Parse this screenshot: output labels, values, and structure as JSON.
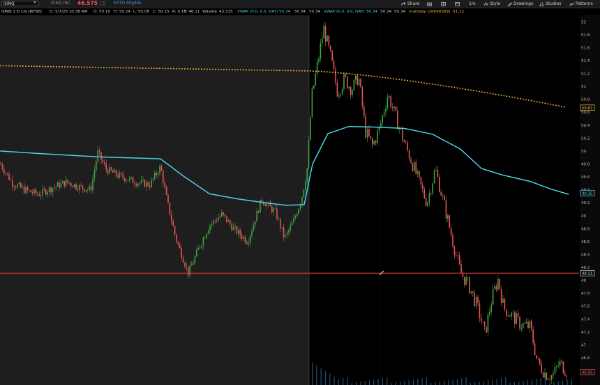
{
  "toolbar": {
    "symbol": "IONQ",
    "company": "IONQ INC",
    "last_price": "46.575",
    "change_lines": [
      "-2.62",
      "-0.82",
      "+0.86"
    ],
    "exchange": "EXTO Eligible",
    "buttons": {
      "share": "Share",
      "timeframe": "1m",
      "style": "Style",
      "drawings": "Drawings",
      "studies": "Studies",
      "patterns": "Patterns"
    }
  },
  "infobar": {
    "title": "IONQ 1 D 1m [NYSE]",
    "date": "D: 5/7/26 10:38 AM",
    "open": "O: 50.19",
    "high": "H: 50.24",
    "low": "L: 50.08",
    "close": "C: 50.15",
    "range": "R: 0.16",
    "y": "Y: 48.11",
    "volume_label": "Volume",
    "volume": "43,315",
    "vwap1_label": "VWAP (0.0, 0.0, DAY)",
    "vwap1_values": [
      "50.34",
      "50.34",
      "50.34"
    ],
    "vwap2_label": "VWAP (0.0, 0.0, DAY)",
    "vwap2_values": [
      "50.34",
      "50.34",
      "50.34"
    ],
    "multiday_label": "multiday (20090309)",
    "multiday_value": "51.12"
  },
  "chart_data": {
    "type": "candlestick",
    "y_axis_ticks": [
      "52",
      "51.8",
      "51.6",
      "51.4",
      "51.2",
      "51",
      "50.8",
      "50.6",
      "50.4",
      "50.2",
      "50",
      "49.8",
      "49.6",
      "49.4",
      "49.2",
      "49",
      "48.8",
      "48.6",
      "48.4",
      "48.2",
      "48",
      "47.8",
      "47.6",
      "47.4",
      "47.2",
      "47",
      "46.8",
      "46.6"
    ],
    "ylim": [
      46.38,
      52.1
    ],
    "price_labels": [
      {
        "value": 50.67,
        "text": "50.67",
        "color": "#f5b63a"
      },
      {
        "value": 49.35,
        "text": "49.35",
        "color": "#45d4e6"
      },
      {
        "value": 48.11,
        "text": "48.11",
        "color": "#c8c8c8"
      },
      {
        "value": 46.58,
        "text": "46.56",
        "color": "#e8545b"
      }
    ],
    "horizontal_line": 48.11,
    "multiday_line": {
      "start": 51.32,
      "end": 50.67
    },
    "vwap_path": [
      [
        0,
        50.0
      ],
      [
        60,
        49.96
      ],
      [
        140,
        49.91
      ],
      [
        230,
        49.88
      ],
      [
        262,
        49.62
      ],
      [
        300,
        49.34
      ],
      [
        340,
        49.26
      ],
      [
        380,
        49.2
      ],
      [
        410,
        49.16
      ],
      [
        436,
        49.17
      ],
      [
        448,
        49.8
      ],
      [
        470,
        50.27
      ],
      [
        500,
        50.38
      ],
      [
        540,
        50.37
      ],
      [
        580,
        50.35
      ],
      [
        620,
        50.26
      ],
      [
        660,
        50.03
      ],
      [
        690,
        49.73
      ],
      [
        720,
        49.63
      ],
      [
        760,
        49.53
      ],
      [
        790,
        49.41
      ],
      [
        815,
        49.33
      ]
    ],
    "price_path": [
      [
        0,
        49.81
      ],
      [
        18,
        49.5
      ],
      [
        35,
        49.4
      ],
      [
        55,
        49.33
      ],
      [
        75,
        49.43
      ],
      [
        95,
        49.52
      ],
      [
        115,
        49.44
      ],
      [
        130,
        49.4
      ],
      [
        140,
        49.98
      ],
      [
        152,
        49.72
      ],
      [
        170,
        49.62
      ],
      [
        195,
        49.52
      ],
      [
        215,
        49.48
      ],
      [
        230,
        49.76
      ],
      [
        240,
        49.2
      ],
      [
        252,
        48.65
      ],
      [
        262,
        48.35
      ],
      [
        270,
        48.11
      ],
      [
        285,
        48.5
      ],
      [
        300,
        48.85
      ],
      [
        318,
        49.02
      ],
      [
        335,
        48.8
      ],
      [
        355,
        48.6
      ],
      [
        375,
        49.25
      ],
      [
        395,
        49.05
      ],
      [
        408,
        48.65
      ],
      [
        420,
        48.9
      ],
      [
        432,
        49.25
      ],
      [
        440,
        49.7
      ],
      [
        447,
        50.85
      ],
      [
        456,
        51.4
      ],
      [
        464,
        51.9
      ],
      [
        474,
        51.45
      ],
      [
        484,
        50.9
      ],
      [
        494,
        51.12
      ],
      [
        504,
        50.95
      ],
      [
        514,
        51.15
      ],
      [
        524,
        50.3
      ],
      [
        534,
        50.08
      ],
      [
        544,
        50.35
      ],
      [
        556,
        50.88
      ],
      [
        568,
        50.5
      ],
      [
        580,
        50.12
      ],
      [
        592,
        49.78
      ],
      [
        602,
        49.48
      ],
      [
        612,
        49.2
      ],
      [
        624,
        49.72
      ],
      [
        636,
        49.2
      ],
      [
        648,
        48.65
      ],
      [
        660,
        48.12
      ],
      [
        672,
        47.92
      ],
      [
        684,
        47.6
      ],
      [
        695,
        47.17
      ],
      [
        705,
        47.72
      ],
      [
        714,
        48.02
      ],
      [
        722,
        47.57
      ],
      [
        734,
        47.45
      ],
      [
        746,
        47.32
      ],
      [
        760,
        47.28
      ],
      [
        770,
        46.74
      ],
      [
        782,
        46.55
      ],
      [
        792,
        46.52
      ],
      [
        802,
        46.72
      ],
      [
        814,
        46.57
      ]
    ],
    "session_split_x": 443,
    "axis_columns": {
      "plot_right": 830,
      "scale_left": 831
    }
  }
}
